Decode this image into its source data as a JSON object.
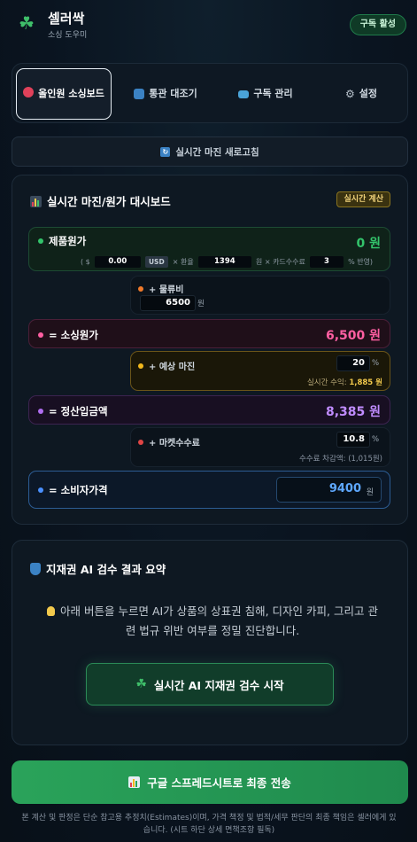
{
  "app": {
    "title": "셀러싹",
    "subtitle": "소싱 도우미",
    "subscription_badge": "구독 활성"
  },
  "tabs": [
    {
      "label": "올인원 소싱보드",
      "icon": "target-icon",
      "active": true
    },
    {
      "label": "통관 대조기",
      "icon": "customs-icon",
      "active": false
    },
    {
      "label": "구독 관리",
      "icon": "card-icon",
      "active": false
    },
    {
      "label": "설정",
      "icon": "gear-icon",
      "active": false
    }
  ],
  "refresh_label": "실시간 마진 새로고침",
  "dashboard": {
    "title": "실시간 마진/원가 대시보드",
    "badge": "실시간 계산",
    "product_cost": {
      "label": "제품원가",
      "value": "0 원",
      "formula": {
        "open": "( $",
        "usd_value": "0.00",
        "usd_unit": "USD",
        "times1": "× 환율",
        "exchange_rate": "1394",
        "won_times": "원 × 카드수수료",
        "card_fee": "3",
        "close": "% 반영)"
      }
    },
    "shipping": {
      "label": "+ 물류비",
      "value": "6500",
      "unit": "원"
    },
    "sourcing_cost": {
      "label": "= 소싱원가",
      "value": "6,500 원"
    },
    "margin": {
      "label": "+ 예상 마진",
      "value": "20",
      "unit": "%",
      "profit_label": "실시간 수익:",
      "profit_value": "1,885 원"
    },
    "settlement": {
      "label": "= 정산입금액",
      "value": "8,385 원"
    },
    "market_fee": {
      "label": "+ 마켓수수료",
      "value": "10.8",
      "unit": "%",
      "deduction_text": "수수료 차감액: (1,015원)"
    },
    "consumer_price": {
      "label": "= 소비자가격",
      "value": "9400",
      "unit": "원"
    }
  },
  "ip_section": {
    "title": "지재권 AI 검수 결과 요약",
    "description": "아래 버튼을 누르면 AI가 상품의 상표권 침해, 디자인 카피, 그리고 관련 법규 위반 여부를 정밀 진단합니다.",
    "button_label": "실시간 AI 지재권 검수 시작"
  },
  "sheet_button_label": "구글 스프레드시트로 최종 전송",
  "disclaimer": "본 계산 및 판정은 단순 참고용 추정치(Estimates)이며, 가격 책정 및 법적/세무 판단의 최종 책임은 셀러에게 있습니다. (시트 하단 상세 면책조항 필독)",
  "colors": {
    "green": "#33c46b",
    "pink": "#ff5fa2",
    "purple": "#c08cff",
    "blue": "#5ea8ff",
    "gold": "#f2c94c"
  }
}
